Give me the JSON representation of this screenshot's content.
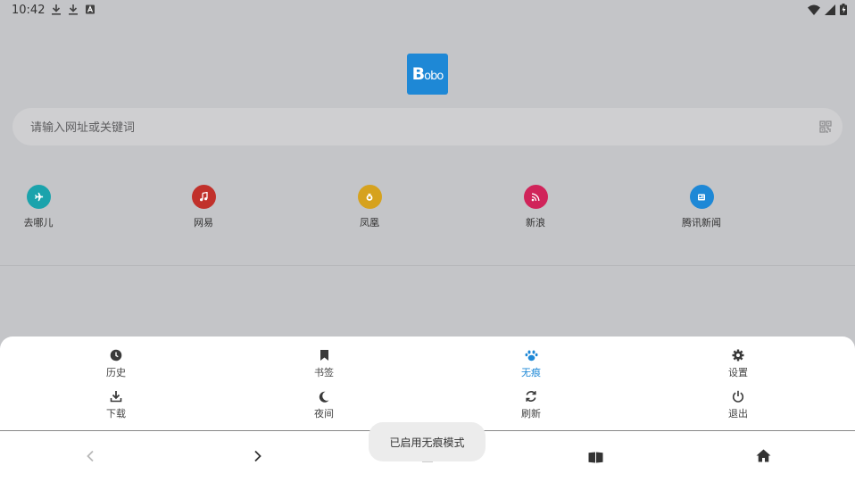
{
  "status_bar": {
    "time": "10:42",
    "left_icons": [
      "download-icon",
      "download-icon",
      "a-box-icon"
    ],
    "right_icons": [
      "wifi-icon",
      "signal-icon",
      "battery-icon"
    ]
  },
  "logo": {
    "text_main": "B",
    "text_small": "obo",
    "color": "#1e88d6"
  },
  "search": {
    "placeholder": "请输入网址或关键词",
    "icon": "qr-code-icon"
  },
  "shortcuts": [
    {
      "label": "去哪儿",
      "color": "#1ba3ac",
      "icon": "plane-icon"
    },
    {
      "label": "网易",
      "color": "#c1312b",
      "icon": "music-note-icon"
    },
    {
      "label": "凤凰",
      "color": "#d6a21e",
      "icon": "phoenix-icon"
    },
    {
      "label": "新浪",
      "color": "#d0245a",
      "icon": "rss-icon"
    },
    {
      "label": "腾讯新闻",
      "color": "#1e88d6",
      "icon": "news-icon"
    }
  ],
  "menu": {
    "history": "历史",
    "bookmarks": "书签",
    "incognito": "无痕",
    "settings": "设置",
    "downloads": "下载",
    "night": "夜间",
    "refresh": "刷新",
    "exit": "退出",
    "active_color": "#1e88d6"
  },
  "bottom_nav": [
    "back-icon",
    "forward-icon",
    "menu-icon",
    "book-icon",
    "home-icon"
  ],
  "toast": {
    "text": "已启用无痕模式"
  }
}
